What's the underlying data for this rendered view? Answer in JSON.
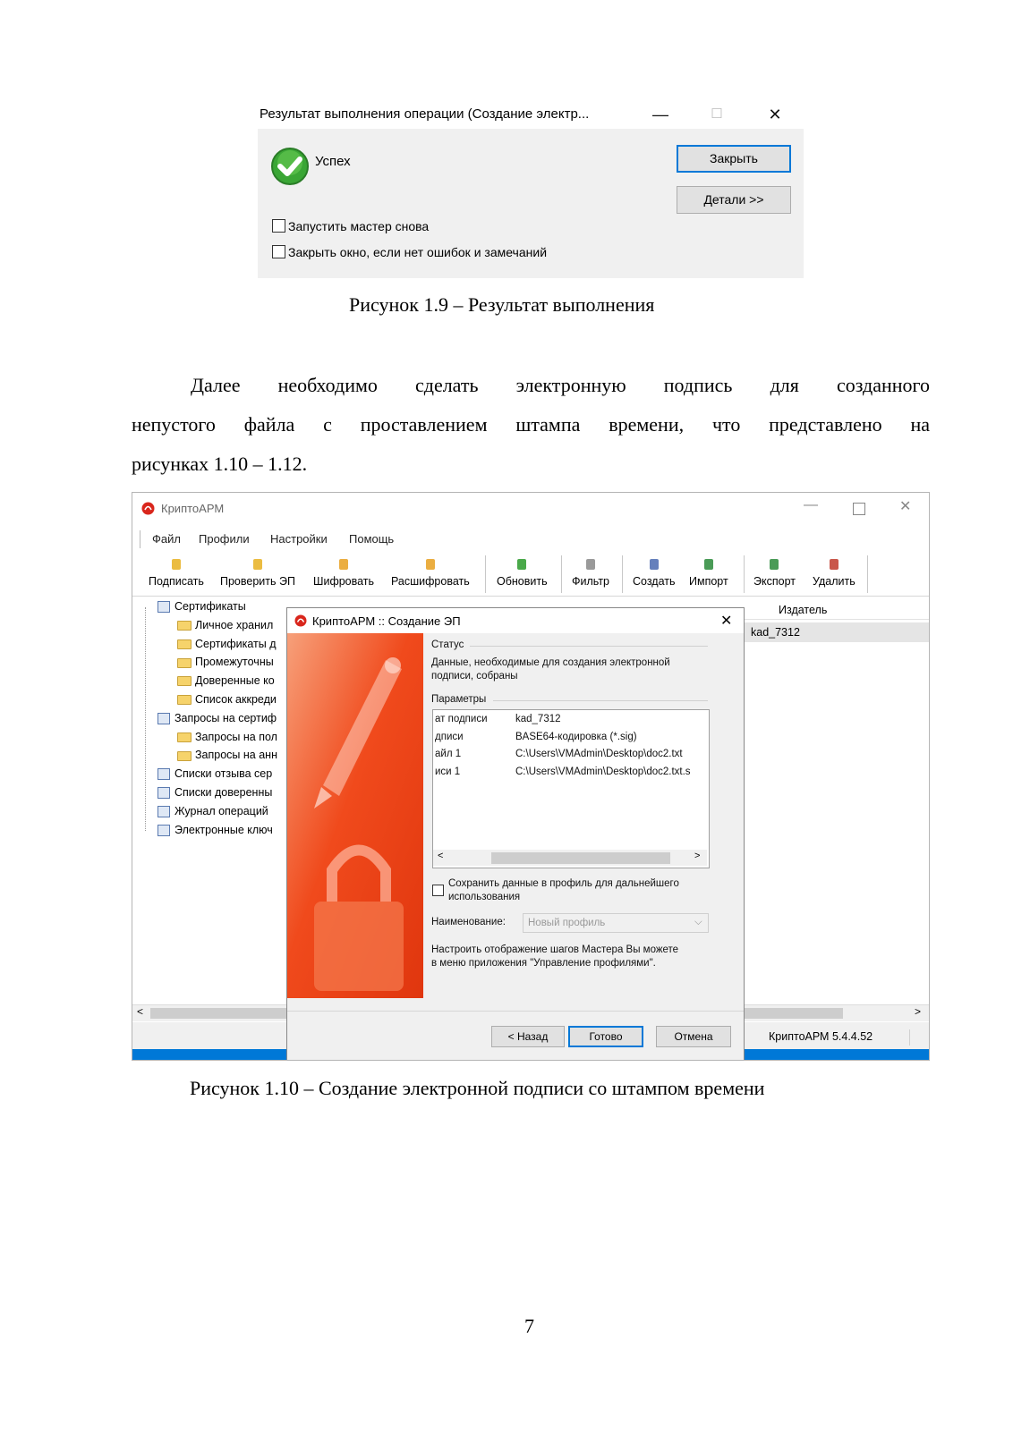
{
  "figure1": {
    "dialog_title": "Результат выполнения операции (Создание электр...",
    "minimize_glyph": "—",
    "maximize_glyph": "☐",
    "close_glyph": "✕",
    "status_text": "Успех",
    "close_button": "Закрыть",
    "details_button": "Детали >>",
    "checkbox_restart": "Запустить мастер снова",
    "checkbox_close": "Закрыть окно, если нет ошибок и замечаний",
    "success_icon": "check-circle-icon",
    "success_color": "#3aa635"
  },
  "caption1": "Рисунок 1.9 – Результат выполнения",
  "paragraph": {
    "line1_words": [
      "Далее",
      "необходимо",
      "сделать",
      "электронную",
      "подпись",
      "для",
      "созданного"
    ],
    "line2_words": [
      "непустого",
      "файла",
      "с",
      "проставлением",
      "штампа",
      "времени,",
      "что",
      "представлено",
      "на"
    ],
    "line3": "рисунках 1.10 – 1.12."
  },
  "figure2": {
    "app_title": "КриптоАРМ",
    "menu": [
      "Файл",
      "Профили",
      "Настройки",
      "Помощь"
    ],
    "toolbar": [
      {
        "label": "Подписать",
        "icon": "pen-icon"
      },
      {
        "label": "Проверить ЭП",
        "icon": "verify-icon"
      },
      {
        "label": "Шифровать",
        "icon": "lock-icon"
      },
      {
        "label": "Расшифровать",
        "icon": "unlock-icon"
      },
      {
        "label": "Обновить",
        "icon": "refresh-icon"
      },
      {
        "label": "Фильтр",
        "icon": "filter-icon"
      },
      {
        "label": "Создать",
        "icon": "create-icon"
      },
      {
        "label": "Импорт",
        "icon": "import-icon"
      },
      {
        "label": "Экспорт",
        "icon": "export-icon"
      },
      {
        "label": "Удалить",
        "icon": "delete-icon"
      }
    ],
    "tree": [
      {
        "label": "Сертификаты",
        "level": 0
      },
      {
        "label": "Личное хранил",
        "level": 1
      },
      {
        "label": "Сертификаты д",
        "level": 1
      },
      {
        "label": "Промежуточны",
        "level": 1
      },
      {
        "label": "Доверенные ко",
        "level": 1
      },
      {
        "label": "Список аккреди",
        "level": 1
      },
      {
        "label": "Запросы на сертиф",
        "level": 0
      },
      {
        "label": "Запросы на пол",
        "level": 1
      },
      {
        "label": "Запросы на анн",
        "level": 1
      },
      {
        "label": "Списки отзыва сер",
        "level": 0
      },
      {
        "label": "Списки доверенны",
        "level": 0
      },
      {
        "label": "Журнал операций",
        "level": 0
      },
      {
        "label": "Электронные ключ",
        "level": 0
      }
    ],
    "list_header_issuer": "Издатель",
    "list_row_issuer": "kad_7312",
    "statusbar_version": "КриптоАРМ 5.4.4.52",
    "accent_bar_color": "#0078d7",
    "dialog": {
      "title": "КриптоАРМ :: Создание ЭП",
      "status_header": "Статус",
      "status_text_line1": "Данные, необходимые для создания электронной",
      "status_text_line2": "подписи, собраны",
      "params_header": "Параметры",
      "params": [
        {
          "name": "ат подписи",
          "value": "kad_7312"
        },
        {
          "name": "дписи",
          "value": "BASE64-кодировка (*.sig)"
        },
        {
          "name": "айл 1",
          "value": "C:\\Users\\VMAdmin\\Desktop\\doc2.txt"
        },
        {
          "name": "иси 1",
          "value": "C:\\Users\\VMAdmin\\Desktop\\doc2.txt.s"
        }
      ],
      "save_checkbox_line1": "Сохранить данные в профиль для дальнейшего",
      "save_checkbox_line2": "использования",
      "name_label": "Наименование:",
      "name_placeholder": "Новый профиль",
      "hint_line1": "Настроить отображение шагов Мастера Вы можете",
      "hint_line2": "в меню приложения \"Управление профилями\".",
      "back_button": "< Назад",
      "finish_button": "Готово",
      "cancel_button": "Отмена",
      "banner_color": "#f04a1c"
    }
  },
  "caption2": "Рисунок 1.10 – Создание электронной подписи со штампом времени",
  "page_number": "7"
}
